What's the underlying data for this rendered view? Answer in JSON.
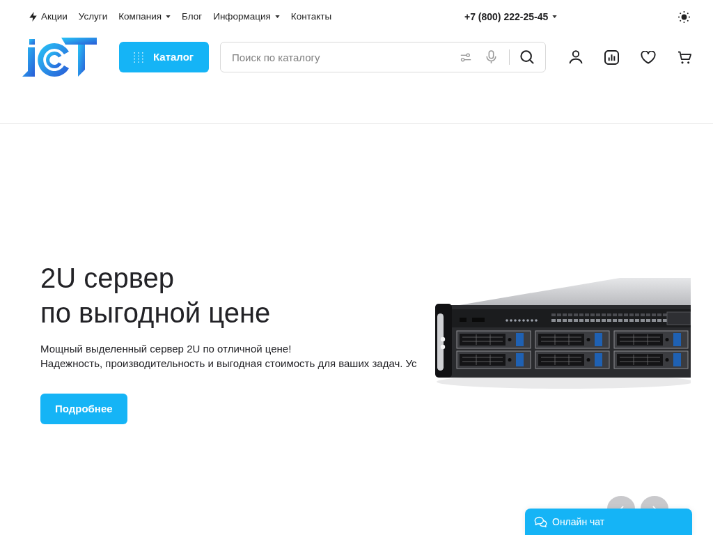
{
  "top_nav": {
    "items": [
      {
        "label": "Акции",
        "kind": "promo",
        "dropdown": false
      },
      {
        "label": "Услуги",
        "kind": "link",
        "dropdown": false
      },
      {
        "label": "Компания",
        "kind": "link",
        "dropdown": true
      },
      {
        "label": "Блог",
        "kind": "link",
        "dropdown": false
      },
      {
        "label": "Информация",
        "kind": "link",
        "dropdown": true
      },
      {
        "label": "Контакты",
        "kind": "link",
        "dropdown": false
      }
    ]
  },
  "phone": {
    "number": "+7 (800) 222-25-45",
    "dropdown": true
  },
  "header": {
    "catalog_button": "Каталог",
    "search": {
      "placeholder": "Поиск по каталогу"
    }
  },
  "hero": {
    "title_lines": [
      "2U сервер",
      "по выгодной цене"
    ],
    "description_lines": [
      "Мощный выделенный сервер 2U по отличной цене!",
      "Надежность, производительность и выгодная стоимость для ваших задач. Ус"
    ],
    "button": "Подробнее"
  },
  "chat_widget": {
    "label": "Онлайн чат"
  }
}
